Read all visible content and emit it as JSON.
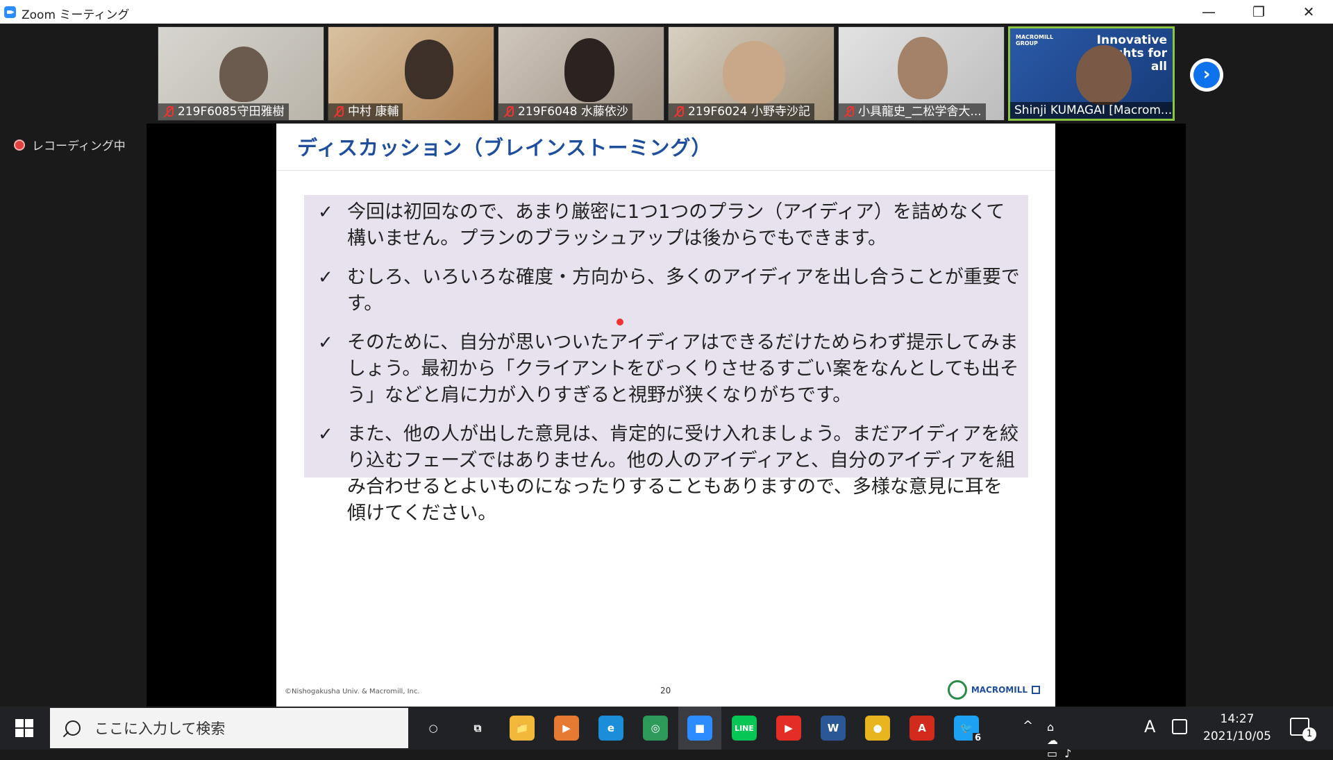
{
  "window": {
    "title": "Zoom ミーティング",
    "minimize": "—",
    "restore": "❐",
    "close": "✕"
  },
  "gallery": {
    "tiles": [
      {
        "name": "219F6085守田雅樹",
        "muted": true
      },
      {
        "name": "中村 康輔",
        "muted": true
      },
      {
        "name": "219F6048 水藤依沙",
        "muted": true
      },
      {
        "name": "219F6024 小野寺沙記",
        "muted": true
      },
      {
        "name": "小具龍史_二松学舎大...",
        "muted": true
      },
      {
        "name": "Shinji KUMAGAI [Macrom...",
        "muted": false,
        "active": true,
        "bg_text": "Innovative insights for all",
        "bg_brand": "MACROMILL GROUP"
      }
    ],
    "next_label": "›"
  },
  "recording": {
    "label": "レコーディング中"
  },
  "slide": {
    "title": "ディスカッション（ブレインストーミング）",
    "bullets": [
      "今回は初回なので、あまり厳密に1つ1つのプラン（アイディア）を詰めなくて構いません。プランのブラッシュアップは後からでもできます。",
      "むしろ、いろいろな確度・方向から、多くのアイディアを出し合うことが重要です。",
      "そのために、自分が思いついたアイディアはできるだけためらわず提示してみましょう。最初から「クライアントをびっくりさせるすごい案をなんとしても出そう」などと肩に力が入りすぎると視野が狭くなりがちです。",
      "また、他の人が出した意見は、肯定的に受け入れましょう。まだアイディアを絞り込むフェーズではありません。他の人のアイディアと、自分のアイディアを組み合わせるとよいものになったりすることもありますので、多様な意見に耳を傾けてください。"
    ],
    "check": "✓",
    "copyright": "©Nishogakusha Univ. & Macromill, Inc.",
    "page_number": "20",
    "logo_text": "MACROMILL"
  },
  "taskbar": {
    "search_placeholder": "ここに入力して検索",
    "apps": [
      {
        "name": "cortana",
        "label": "○",
        "color": "#202226"
      },
      {
        "name": "task-view",
        "label": "⧉",
        "color": "#202226"
      },
      {
        "name": "file-explorer",
        "label": "📁",
        "color": "#f2b83a"
      },
      {
        "name": "media-app",
        "label": "▶",
        "color": "#e77a33"
      },
      {
        "name": "edge",
        "label": "e",
        "color": "#1b8dd9"
      },
      {
        "name": "app-green",
        "label": "◎",
        "color": "#2e9a5a"
      },
      {
        "name": "zoom",
        "label": "■",
        "color": "#2d8cff",
        "active": true
      },
      {
        "name": "line",
        "label": "LINE",
        "color": "#06c755"
      },
      {
        "name": "youtube",
        "label": "▶",
        "color": "#e52d27"
      },
      {
        "name": "word",
        "label": "W",
        "color": "#2b5797"
      },
      {
        "name": "chrome",
        "label": "●",
        "color": "#e8b51e"
      },
      {
        "name": "acrobat",
        "label": "A",
        "color": "#d32a1e"
      },
      {
        "name": "twitter",
        "label": "🐦",
        "color": "#1da1f2",
        "badge": "6"
      }
    ],
    "tray": {
      "chevron": "^",
      "ime": "A"
    },
    "time": "14:27",
    "date": "2021/10/05",
    "notification_count": "1"
  }
}
